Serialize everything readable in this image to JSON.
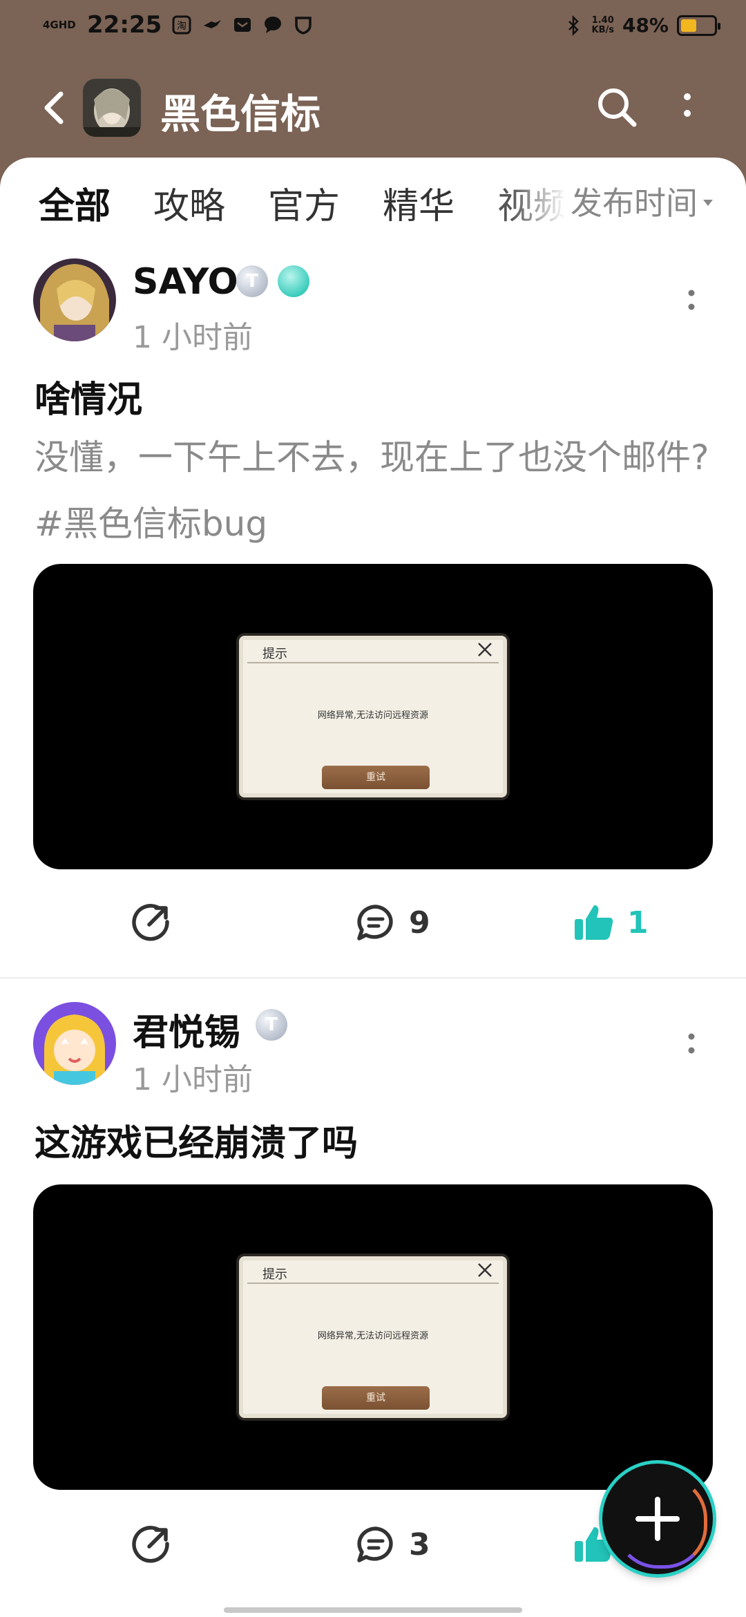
{
  "status_bar": {
    "network": "4GHD",
    "time": "22:25",
    "speed_value": "1.40",
    "speed_unit": "KB/s",
    "battery": "48%",
    "battery_level": 0.48,
    "icons": [
      "taobao-icon",
      "bird-icon",
      "mail-icon",
      "chat-bubble-icon",
      "shield-icon",
      "bluetooth-icon"
    ]
  },
  "header": {
    "title": "黑色信标",
    "back_icon": "chevron-left-icon",
    "search_icon": "search-icon",
    "more_icon": "vertical-dots-icon"
  },
  "tabs": [
    {
      "label": "全部",
      "active": true
    },
    {
      "label": "攻略",
      "active": false
    },
    {
      "label": "官方",
      "active": false
    },
    {
      "label": "精华",
      "active": false
    },
    {
      "label": "视频",
      "active": false
    }
  ],
  "sort": {
    "label": "发布时间"
  },
  "posts": [
    {
      "author": "SAYO",
      "time": "1 小时前",
      "title": "啥情况",
      "body": "没懂，一下午上不去，现在上了也没个邮件?#黑色信标bug",
      "image": {
        "dialog_title": "提示",
        "message": "网络异常,无法访问远程资源",
        "button": "重试"
      },
      "comments": "9",
      "likes": "1",
      "liked": true
    },
    {
      "author": "君悦锡",
      "time": "1 小时前",
      "title": "这游戏已经崩溃了吗",
      "body": "",
      "image": {
        "dialog_title": "提示",
        "message": "网络异常,无法访问远程资源",
        "button": "重试"
      },
      "comments": "3",
      "likes": "",
      "liked": true
    }
  ],
  "fab": {
    "icon": "plus-icon"
  },
  "colors": {
    "header_bg": "#7b6355",
    "accent": "#2ad0c5",
    "liked": "#22c3b8",
    "battery": "#f2b61f"
  }
}
